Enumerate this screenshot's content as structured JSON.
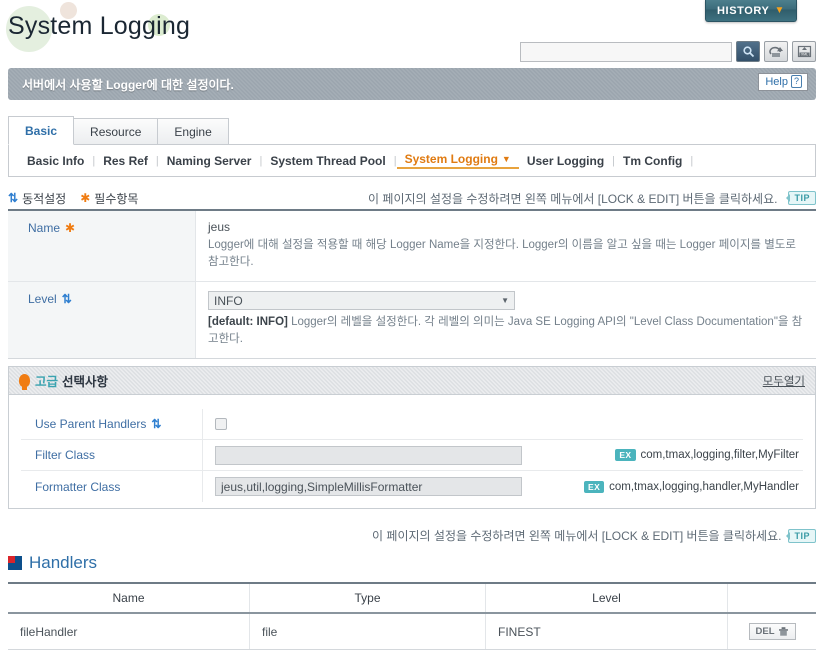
{
  "header": {
    "title": "System Logging",
    "history_button": "HISTORY",
    "history_caret": "▼",
    "search_value": "",
    "search_placeholder": "",
    "icons": {
      "search": "search-icon",
      "export": "export-icon",
      "xml": "xml-upload-icon"
    }
  },
  "description_bar": {
    "text": "서버에서 사용할 Logger에 대한 설정이다.",
    "help_label": "Help",
    "help_mark": "?"
  },
  "tabs": [
    {
      "label": "Basic",
      "active": true
    },
    {
      "label": "Resource",
      "active": false
    },
    {
      "label": "Engine",
      "active": false
    }
  ],
  "subnav": [
    {
      "label": "Basic Info",
      "active": false
    },
    {
      "label": "Res Ref",
      "active": false
    },
    {
      "label": "Naming Server",
      "active": false
    },
    {
      "label": "System Thread Pool",
      "active": false
    },
    {
      "label": "System Logging",
      "active": true
    },
    {
      "label": "User Logging",
      "active": false
    },
    {
      "label": "Tm Config",
      "active": false
    }
  ],
  "legend": {
    "dynamic_label": "동적설정",
    "required_label": "필수항목",
    "note": "이 페이지의 설정을 수정하려면 왼쪽 메뉴에서 [LOCK & EDIT] 버튼을 클릭하세요.",
    "tip": "TIP"
  },
  "form": {
    "rows": [
      {
        "label": "Name",
        "marker": "required",
        "value": "jeus",
        "description": "Logger에 대해 설정을 적용할 때 해당 Logger Name을 지정한다. Logger의 이름을 알고 싶을 때는 Logger 페이지를 별도로 참고한다."
      },
      {
        "label": "Level",
        "marker": "dynamic",
        "selected": "INFO",
        "default_tag": "[default: INFO]",
        "description": "Logger의 레벨을 설정한다. 각 레벨의 의미는 Java SE Logging API의 \"Level Class Documentation\"을 참고한다."
      }
    ]
  },
  "advanced": {
    "title_accent": "고급",
    "title_rest": "선택사항",
    "expand_all": "모두열기",
    "rows": [
      {
        "label": "Use Parent Handlers",
        "marker": "dynamic",
        "type": "checkbox",
        "checked": false,
        "example": ""
      },
      {
        "label": "Filter Class",
        "marker": "none",
        "type": "text",
        "value": "",
        "example_badge": "EX",
        "example": "com,tmax,logging,filter,MyFilter"
      },
      {
        "label": "Formatter Class",
        "marker": "none",
        "type": "text",
        "value": "jeus,util,logging,SimpleMillisFormatter",
        "example_badge": "EX",
        "example": "com,tmax,logging,handler,MyHandler"
      }
    ]
  },
  "footer_note": {
    "text": "이 페이지의 설정을 수정하려면 왼쪽 메뉴에서 [LOCK & EDIT] 버튼을 클릭하세요.",
    "tip": "TIP"
  },
  "handlers": {
    "title": "Handlers",
    "columns": [
      "Name",
      "Type",
      "Level",
      ""
    ],
    "rows": [
      {
        "name": "fileHandler",
        "type": "file",
        "level": "FINEST",
        "action": "DEL"
      }
    ]
  }
}
